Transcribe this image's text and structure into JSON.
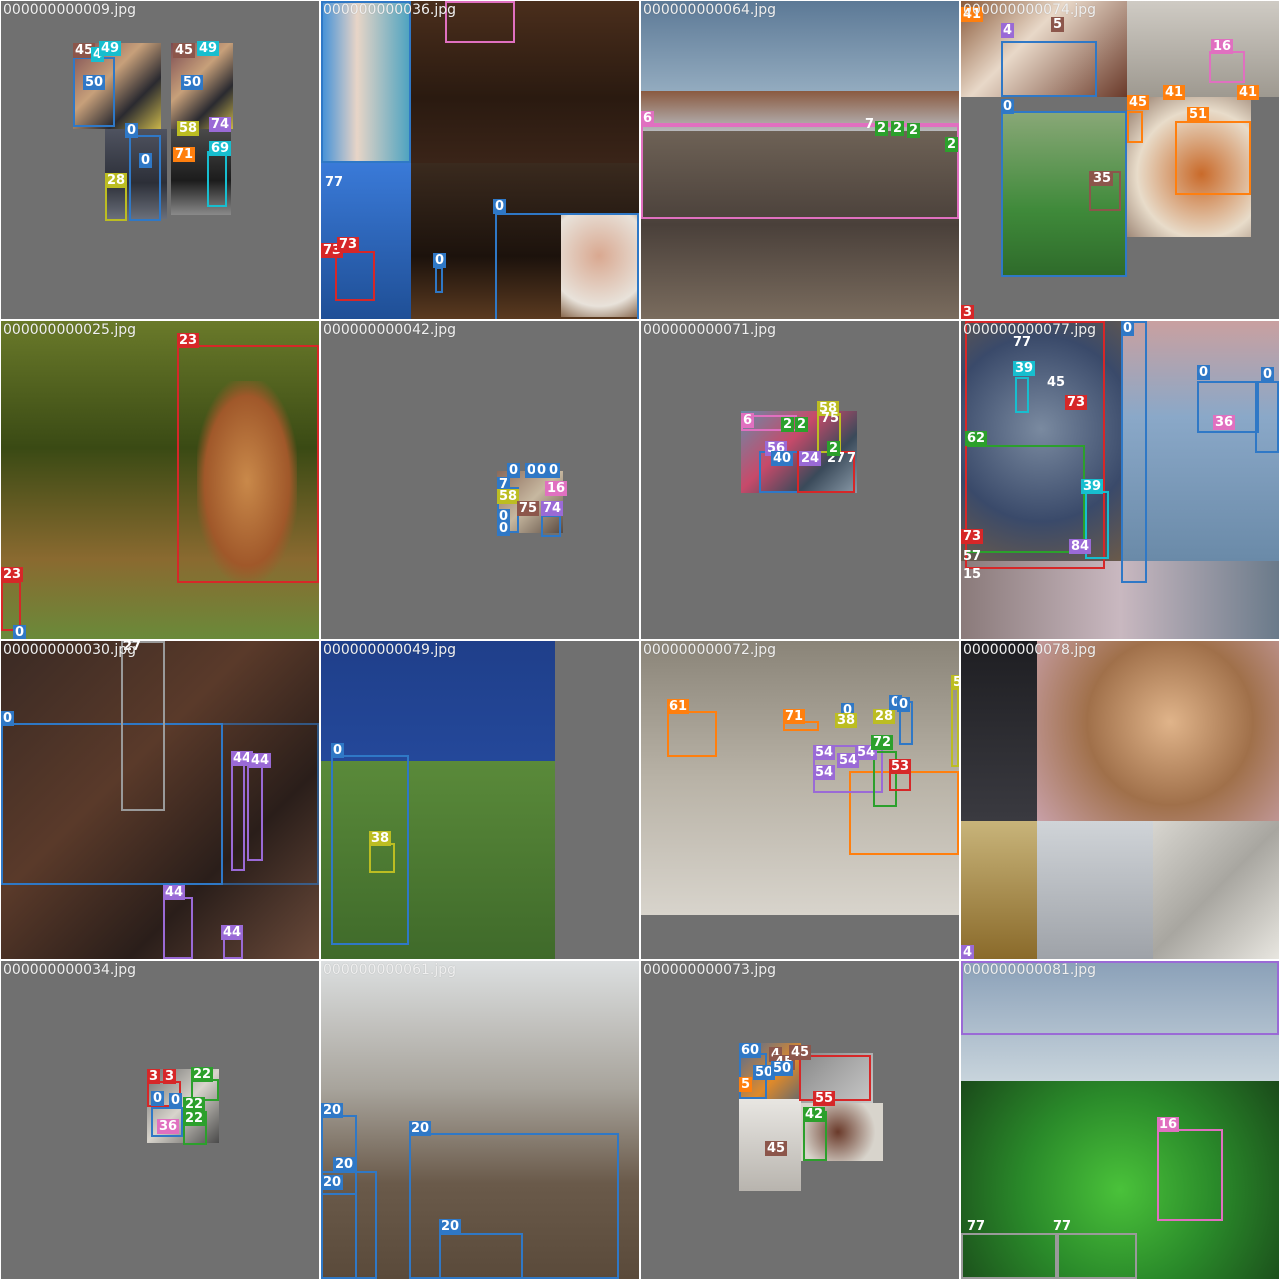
{
  "mosaic": {
    "tiles": [
      {
        "filename": "000000000009.jpg",
        "labels": [
          "45",
          "4",
          "49",
          "45",
          "49",
          "50",
          "50",
          "0",
          "58",
          "74",
          "0",
          "71",
          "69",
          "28"
        ]
      },
      {
        "filename": "000000000036.jpg",
        "labels": [
          "77",
          "0",
          "0",
          "73",
          "73"
        ]
      },
      {
        "filename": "000000000064.jpg",
        "labels": [
          "6",
          "7",
          "2",
          "2",
          "2",
          "2"
        ]
      },
      {
        "filename": "000000000074.jpg",
        "labels": [
          "41",
          "4",
          "5",
          "16",
          "0",
          "45",
          "41",
          "41",
          "51",
          "35",
          "3"
        ]
      },
      {
        "filename": "000000000025.jpg",
        "labels": [
          "23",
          "23",
          "0"
        ]
      },
      {
        "filename": "000000000042.jpg",
        "labels": [
          "0",
          "0",
          "0",
          "0",
          "7",
          "58",
          "16",
          "0",
          "75",
          "74",
          "0"
        ]
      },
      {
        "filename": "000000000071.jpg",
        "labels": [
          "6",
          "2",
          "2",
          "58",
          "75",
          "56",
          "40",
          "24",
          "27",
          "7",
          "2"
        ]
      },
      {
        "filename": "000000000077.jpg",
        "labels": [
          "77",
          "39",
          "45",
          "73",
          "0",
          "0",
          "36",
          "62",
          "39",
          "73",
          "57",
          "15",
          "84",
          "0"
        ]
      },
      {
        "filename": "000000000030.jpg",
        "labels": [
          "27",
          "0",
          "44",
          "44",
          "44",
          "44"
        ]
      },
      {
        "filename": "000000000049.jpg",
        "labels": [
          "0",
          "38"
        ]
      },
      {
        "filename": "000000000072.jpg",
        "labels": [
          "61",
          "71",
          "0",
          "38",
          "28",
          "0",
          "0",
          "54",
          "54",
          "54",
          "72",
          "53",
          "54",
          "5"
        ]
      },
      {
        "filename": "000000000078.jpg",
        "labels": [
          "4"
        ]
      },
      {
        "filename": "000000000034.jpg",
        "labels": [
          "3",
          "3",
          "22",
          "0",
          "0",
          "22",
          "36",
          "22"
        ]
      },
      {
        "filename": "000000000061.jpg",
        "labels": [
          "20",
          "20",
          "20",
          "20",
          "20"
        ]
      },
      {
        "filename": "000000000073.jpg",
        "labels": [
          "60",
          "4",
          "45",
          "45",
          "5",
          "50",
          "50",
          "55",
          "42",
          "45"
        ]
      },
      {
        "filename": "000000000081.jpg",
        "labels": [
          "16",
          "77",
          "77"
        ]
      }
    ]
  },
  "colors": {
    "tile_background": "#707070",
    "person": "#2f78c6",
    "pink": "#e070c0",
    "green": "#2ca02c",
    "red": "#d62728",
    "orange": "#ff7f0e",
    "purple": "#9a6ad6",
    "cyan": "#17becf",
    "olive": "#bcbd22",
    "brown": "#8c564b",
    "gray": "#9a9a9a"
  }
}
